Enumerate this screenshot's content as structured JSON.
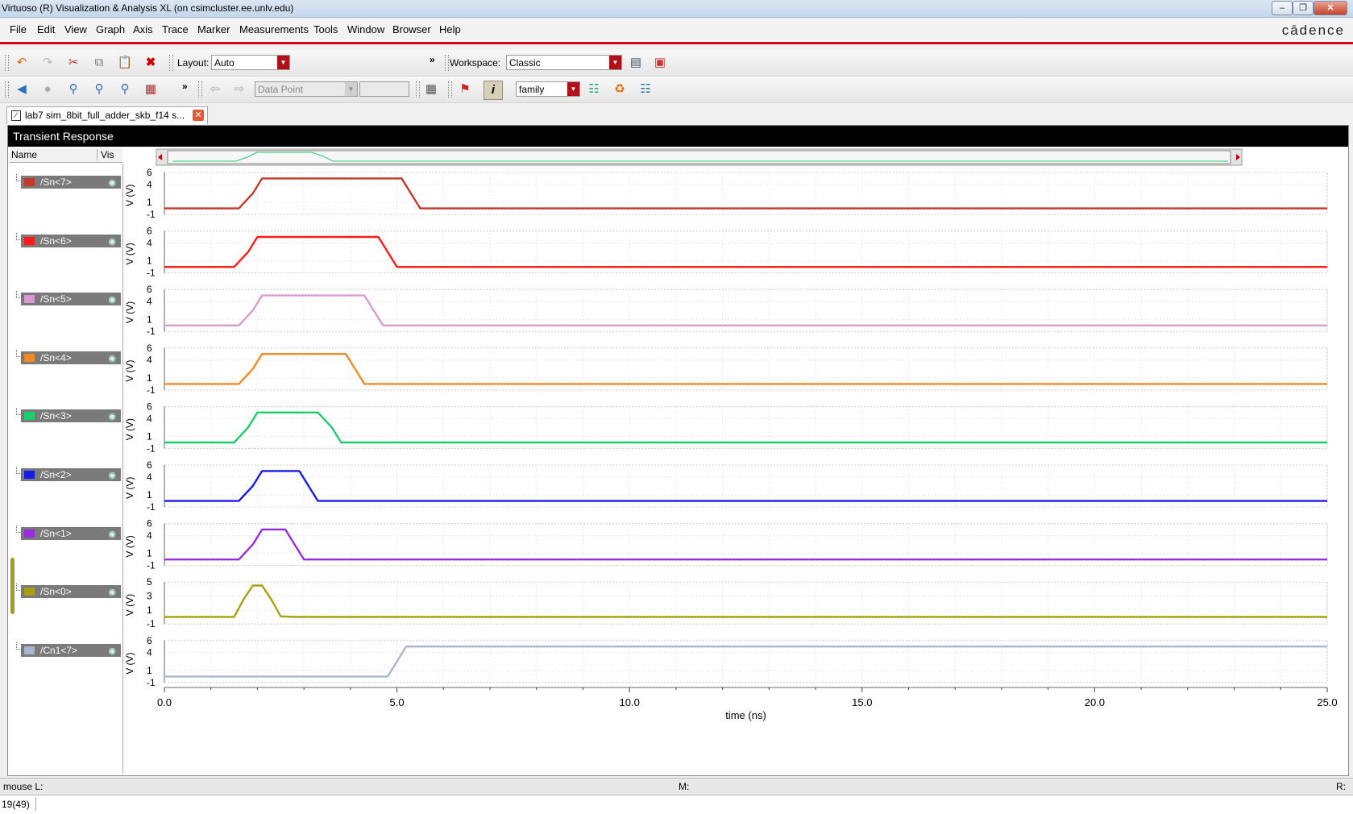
{
  "window": {
    "title": "Virtuoso (R) Visualization & Analysis XL (on csimcluster.ee.unlv.edu)"
  },
  "menu": {
    "items": [
      "File",
      "Edit",
      "View",
      "Graph",
      "Axis",
      "Trace",
      "Marker",
      "Measurements",
      "Tools",
      "Window",
      "Browser",
      "Help"
    ],
    "brand": "cādence"
  },
  "toolbar1": {
    "layout_label": "Layout:",
    "layout_value": "Auto",
    "more": "»",
    "workspace_label": "Workspace:",
    "workspace_value": "Classic"
  },
  "toolbar2": {
    "more": "»",
    "marker_type": "Data Point",
    "family_value": "family"
  },
  "tab": {
    "label": "lab7 sim_8bit_full_adder_skb_f14 s..."
  },
  "plot": {
    "title": "Transient Response",
    "name_header": "Name",
    "vis_header": "Vis"
  },
  "status": {
    "mouse_l": "mouse L:",
    "mouse_m": "M:",
    "mouse_r": "R:",
    "counter": "19(49)"
  },
  "chart_data": {
    "type": "line",
    "title": "Transient Response",
    "xlabel": "time (ns)",
    "ylabel": "V (V)",
    "xlim": [
      0,
      25
    ],
    "x_ticks": [
      "0.0",
      "5.0",
      "10.0",
      "15.0",
      "20.0",
      "25.0"
    ],
    "grid": true,
    "strips": [
      {
        "name": "/Sn<7>",
        "color": "#c0392b",
        "yticks": [
          "6",
          "4",
          "1",
          "-1"
        ],
        "ylim": [
          -1,
          6
        ],
        "points": [
          [
            0,
            0
          ],
          [
            1.6,
            0
          ],
          [
            1.9,
            2.5
          ],
          [
            2.1,
            5
          ],
          [
            5.1,
            5
          ],
          [
            5.3,
            2.5
          ],
          [
            5.5,
            0
          ],
          [
            25,
            0
          ]
        ]
      },
      {
        "name": "/Sn<6>",
        "color": "#ff1a1a",
        "yticks": [
          "6",
          "4",
          "1",
          "-1"
        ],
        "ylim": [
          -1,
          6
        ],
        "points": [
          [
            0,
            0
          ],
          [
            1.5,
            0
          ],
          [
            1.8,
            2.5
          ],
          [
            2.0,
            5
          ],
          [
            4.6,
            5
          ],
          [
            4.8,
            2.5
          ],
          [
            5.0,
            0
          ],
          [
            25,
            0
          ]
        ]
      },
      {
        "name": "/Sn<5>",
        "color": "#d89ad0",
        "yticks": [
          "6",
          "4",
          "1",
          "-1"
        ],
        "ylim": [
          -1,
          6
        ],
        "points": [
          [
            0,
            0
          ],
          [
            1.6,
            0
          ],
          [
            1.9,
            2.5
          ],
          [
            2.1,
            5
          ],
          [
            4.3,
            5
          ],
          [
            4.5,
            2.5
          ],
          [
            4.7,
            0
          ],
          [
            25,
            0
          ]
        ]
      },
      {
        "name": "/Sn<4>",
        "color": "#f08a24",
        "yticks": [
          "6",
          "4",
          "1",
          "-1"
        ],
        "ylim": [
          -1,
          6
        ],
        "points": [
          [
            0,
            0
          ],
          [
            1.6,
            0
          ],
          [
            1.9,
            2.5
          ],
          [
            2.1,
            5
          ],
          [
            3.9,
            5
          ],
          [
            4.1,
            2.5
          ],
          [
            4.3,
            0
          ],
          [
            25,
            0
          ]
        ]
      },
      {
        "name": "/Sn<3>",
        "color": "#1fcc6a",
        "yticks": [
          "6",
          "4",
          "1",
          "-1"
        ],
        "ylim": [
          -1,
          6
        ],
        "points": [
          [
            0,
            0
          ],
          [
            1.5,
            0
          ],
          [
            1.8,
            2.5
          ],
          [
            2.0,
            5
          ],
          [
            3.3,
            5
          ],
          [
            3.6,
            2.5
          ],
          [
            3.8,
            0
          ],
          [
            25,
            0
          ]
        ]
      },
      {
        "name": "/Sn<2>",
        "color": "#1a1ae6",
        "yticks": [
          "6",
          "4",
          "1",
          "-1"
        ],
        "ylim": [
          -1,
          6
        ],
        "points": [
          [
            0,
            0
          ],
          [
            1.6,
            0
          ],
          [
            1.9,
            2.5
          ],
          [
            2.1,
            5
          ],
          [
            2.9,
            5
          ],
          [
            3.1,
            2.5
          ],
          [
            3.3,
            0
          ],
          [
            25,
            0
          ]
        ]
      },
      {
        "name": "/Sn<1>",
        "color": "#9a2be0",
        "yticks": [
          "6",
          "4",
          "1",
          "-1"
        ],
        "ylim": [
          -1,
          6
        ],
        "points": [
          [
            0,
            0
          ],
          [
            1.6,
            0
          ],
          [
            1.9,
            2.5
          ],
          [
            2.1,
            5
          ],
          [
            2.6,
            5
          ],
          [
            2.8,
            2.5
          ],
          [
            3.0,
            0
          ],
          [
            25,
            0
          ]
        ]
      },
      {
        "name": "/Sn<0>",
        "color": "#a8a010",
        "yticks": [
          "5",
          "3",
          "1",
          "-1"
        ],
        "ylim": [
          -1,
          5
        ],
        "points": [
          [
            0,
            0
          ],
          [
            1.5,
            0
          ],
          [
            1.7,
            2.5
          ],
          [
            1.9,
            4.5
          ],
          [
            2.1,
            4.5
          ],
          [
            2.3,
            2.5
          ],
          [
            2.5,
            0.1
          ],
          [
            2.8,
            0
          ],
          [
            25,
            0
          ]
        ]
      },
      {
        "name": "/Cn1<7>",
        "color": "#a8b4d0",
        "yticks": [
          "6",
          "4",
          "1",
          "-1"
        ],
        "ylim": [
          -1,
          6
        ],
        "points": [
          [
            0,
            0
          ],
          [
            4.8,
            0
          ],
          [
            5.0,
            2.5
          ],
          [
            5.2,
            5
          ],
          [
            25,
            5
          ]
        ]
      }
    ]
  }
}
